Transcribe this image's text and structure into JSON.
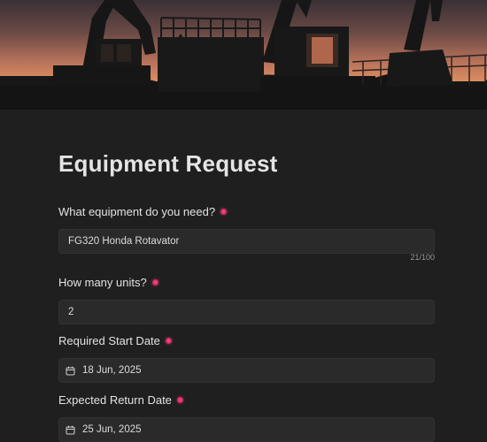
{
  "form": {
    "title": "Equipment Request",
    "fields": [
      {
        "label": "What equipment do you need?",
        "required": true,
        "value": "FG320 Honda Rotavator",
        "counter": "21/100"
      },
      {
        "label": "How many units?",
        "required": true,
        "value": "2"
      },
      {
        "label": "Required Start Date",
        "required": true,
        "value": "18 Jun, 2025",
        "icon": "calendar-icon"
      },
      {
        "label": "Expected Return Date",
        "required": true,
        "value": "25 Jun, 2025",
        "icon": "calendar-icon"
      }
    ]
  },
  "colors": {
    "background": "#1f1f1f",
    "input_background": "#2a2a2a",
    "required_marker": "#e0336f"
  }
}
